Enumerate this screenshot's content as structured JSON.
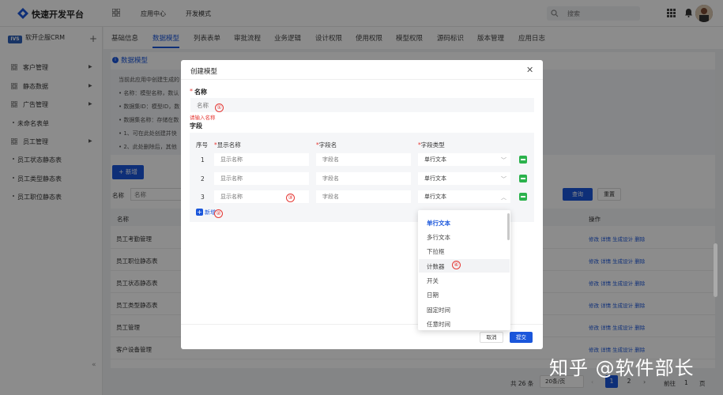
{
  "header": {
    "app_title": "快速开发平台",
    "nav": [
      "应用中心",
      "开发模式"
    ],
    "search_placeholder": "搜索"
  },
  "sidebar": {
    "app_badge": "IVS",
    "app_name": "软开企服CRM",
    "items": [
      {
        "label": "客户管理",
        "has_icon": true,
        "has_arrow": true
      },
      {
        "label": "静态数据",
        "has_icon": true,
        "has_arrow": true
      },
      {
        "label": "广告管理",
        "has_icon": true,
        "has_arrow": true
      },
      {
        "label": "未命名表单",
        "has_icon": false,
        "has_arrow": false
      },
      {
        "label": "员工管理",
        "has_icon": true,
        "has_arrow": true
      },
      {
        "label": "员工状态静态表",
        "has_icon": false,
        "has_arrow": false
      },
      {
        "label": "员工类型静态表",
        "has_icon": false,
        "has_arrow": false
      },
      {
        "label": "员工职位静态表",
        "has_icon": false,
        "has_arrow": false
      }
    ],
    "collapse": "«"
  },
  "tabs": [
    "基础信息",
    "数据模型",
    "列表表单",
    "审批流程",
    "业务逻辑",
    "设计权限",
    "使用权限",
    "模型权限",
    "源码标识",
    "版本管理",
    "应用日志"
  ],
  "active_tab": "数据模型",
  "main": {
    "section_title": "数据模型",
    "info_lines": [
      "当前此应用中创建生成的",
      "• 名称：模型名称，数认",
      "• 数据集ID：模型ID，数",
      "• 数据集名称：存储在数",
      "• 1、可在此处创建并快",
      "• 2、此处删除后，其他"
    ],
    "new_button": "+ 新增",
    "filter_label": "名称",
    "filter_placeholder": "名称",
    "query_button": "查询",
    "reset_button": "重置",
    "table_headers": {
      "name": "名称",
      "ops": "操作"
    },
    "rows": [
      "员工考勤管理",
      "员工职位静态表",
      "员工状态静态表",
      "员工类型静态表",
      "员工管理",
      "客户设备管理"
    ],
    "row_ops": "修改  详情  生成设计  删除"
  },
  "pagination": {
    "total": "共 26 条",
    "page_size": "20条/页",
    "pages": [
      "1",
      "2"
    ],
    "goto_label": "前往",
    "goto_value": "1",
    "page_suffix": "页"
  },
  "modal": {
    "title": "创建模型",
    "name_label": "名称",
    "name_placeholder": "名称",
    "name_error": "请输入名称",
    "field_section": "字段",
    "columns": {
      "no": "序号",
      "display": "显示名称",
      "field": "字段名",
      "type": "字段类型"
    },
    "rows": [
      {
        "no": "1",
        "display_ph": "显示名称",
        "field_ph": "字段名",
        "type": "单行文本",
        "open": false
      },
      {
        "no": "2",
        "display_ph": "显示名称",
        "field_ph": "字段名",
        "type": "单行文本",
        "open": false
      },
      {
        "no": "3",
        "display_ph": "显示名称",
        "field_ph": "字段名",
        "type": "单行文本",
        "open": true
      }
    ],
    "add_field": "新增",
    "cancel": "取消",
    "submit": "提交",
    "markers": [
      "①",
      "②",
      "③",
      "④"
    ]
  },
  "dropdown": {
    "options": [
      "单行文本",
      "多行文本",
      "下拉框",
      "计数器",
      "开关",
      "日期",
      "固定时间",
      "任意时间"
    ],
    "selected": "单行文本",
    "hovered": "计数器"
  },
  "watermark": "知乎 @软件部长",
  "colors": {
    "primary": "#1a56db",
    "danger": "#e53935",
    "success": "#2bb24c"
  }
}
